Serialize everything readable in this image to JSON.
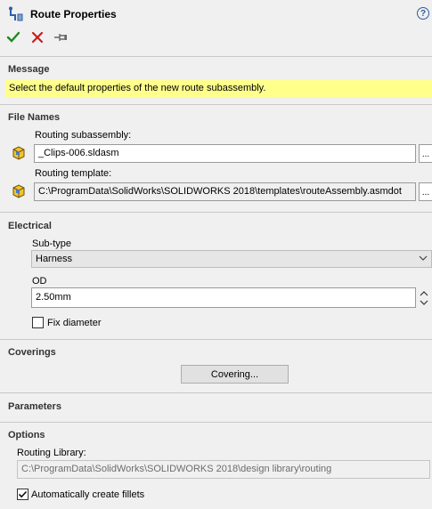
{
  "header": {
    "title": "Route Properties",
    "help_label": "?",
    "icons": {
      "title": "route-properties-icon",
      "ok": "check-icon",
      "cancel": "close-icon",
      "pin": "pushpin-icon"
    }
  },
  "colors": {
    "ok": "#1e8a1e",
    "cancel": "#c81e1e",
    "message_highlight": "#ffff8c"
  },
  "message": {
    "heading": "Message",
    "text": "Select the default properties of the new route subassembly."
  },
  "file_names": {
    "heading": "File Names",
    "subassembly_label": "Routing subassembly:",
    "subassembly_value": "_Clips-006.sldasm",
    "template_label": "Routing template:",
    "template_value": "C:\\ProgramData\\SolidWorks\\SOLIDWORKS 2018\\templates\\routeAssembly.asmdot",
    "browse_label": "..."
  },
  "electrical": {
    "heading": "Electrical",
    "subtype_label": "Sub-type",
    "subtype_value": "Harness",
    "od_label": "OD",
    "od_value": "2.50mm",
    "fix_diameter_label": "Fix diameter",
    "fix_diameter_checked": false
  },
  "coverings": {
    "heading": "Coverings",
    "button_label": "Covering..."
  },
  "parameters": {
    "heading": "Parameters"
  },
  "options": {
    "heading": "Options",
    "library_label": "Routing Library:",
    "library_value": "C:\\ProgramData\\SolidWorks\\SOLIDWORKS 2018\\design library\\routing",
    "auto_fillets_label": "Automatically create fillets",
    "auto_fillets_checked": true
  }
}
